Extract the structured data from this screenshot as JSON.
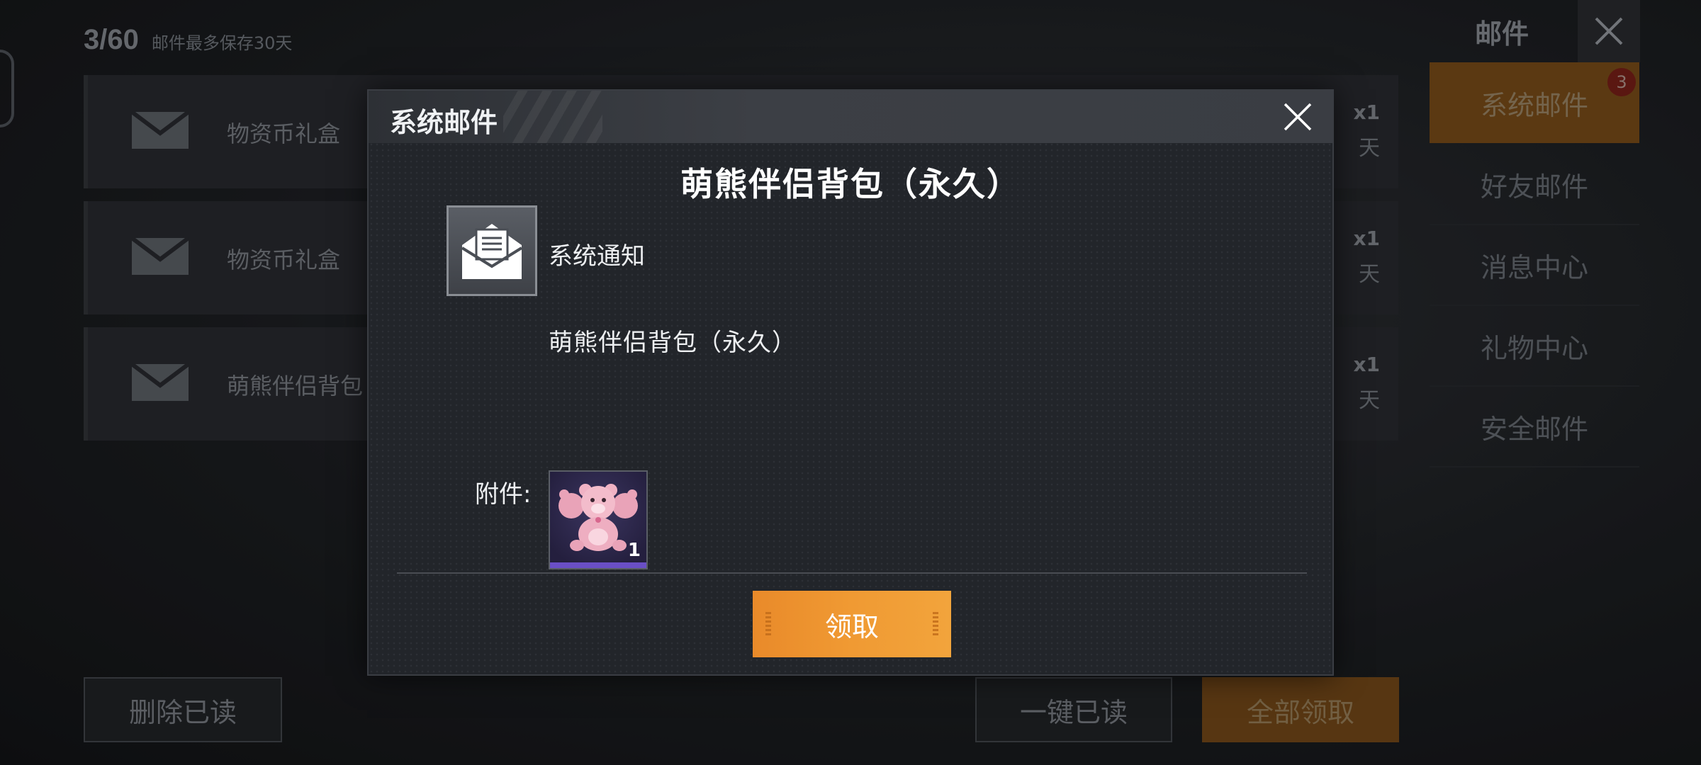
{
  "list": {
    "counter": "3/60",
    "limit_note": "邮件最多保存30天",
    "mails": [
      {
        "title": "物资币礼盒",
        "qty": "x1",
        "days": "天"
      },
      {
        "title": "物资币礼盒",
        "qty": "x1",
        "days": "天"
      },
      {
        "title": "萌熊伴侣背包（",
        "qty": "x1",
        "days": "天"
      }
    ],
    "delete_read_label": "删除已读",
    "mark_all_read_label": "一键已读",
    "claim_all_label": "全部领取"
  },
  "nav": {
    "title": "邮件",
    "items": [
      {
        "label": "系统邮件",
        "active": true,
        "badge": "3"
      },
      {
        "label": "好友邮件"
      },
      {
        "label": "消息中心"
      },
      {
        "label": "礼物中心"
      },
      {
        "label": "安全邮件"
      }
    ]
  },
  "dialog": {
    "title": "系统邮件",
    "heading": "萌熊伴侣背包（永久）",
    "sender": "系统通知",
    "body": "萌熊伴侣背包（永久）",
    "attachment_label": "附件:",
    "attachment": {
      "icon": "pink-bear-backpack",
      "count": "1"
    },
    "claim_label": "领取"
  },
  "colors": {
    "accent_orange": "#f09a33",
    "rarity_purple": "#6a4fc6"
  }
}
